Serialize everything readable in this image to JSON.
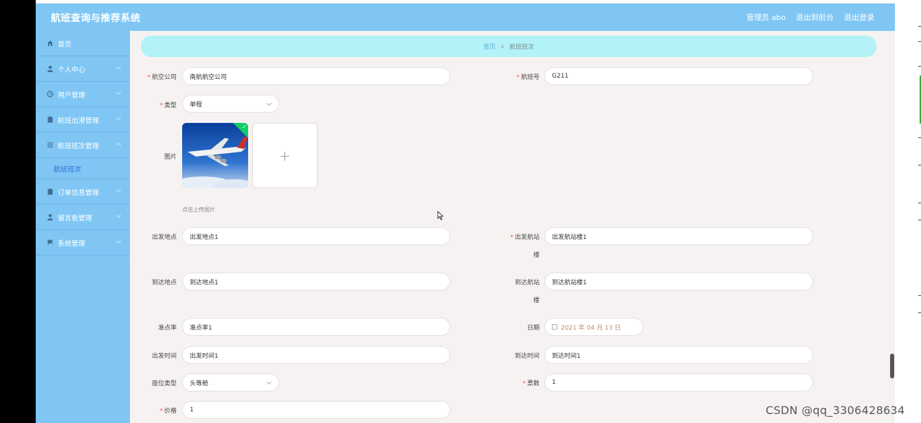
{
  "app": {
    "title": "航班查询与推荐系统"
  },
  "header": {
    "admin_label": "管理员 abo",
    "to_front_label": "退出到前台",
    "logout_label": "退出登录"
  },
  "sidebar": {
    "items": [
      {
        "label": "首页",
        "icon": "home-icon"
      },
      {
        "label": "个人中心",
        "icon": "user-icon"
      },
      {
        "label": "用户管理",
        "icon": "clock-icon"
      },
      {
        "label": "航班出港管理",
        "icon": "clipboard-icon"
      },
      {
        "label": "航班班次管理",
        "icon": "list-icon",
        "expanded": true,
        "children": [
          {
            "label": "航班班次",
            "active": true
          }
        ]
      },
      {
        "label": "订单信息管理",
        "icon": "clipboard-icon"
      },
      {
        "label": "留言板管理",
        "icon": "user-icon"
      },
      {
        "label": "系统管理",
        "icon": "flag-icon"
      }
    ]
  },
  "breadcrumb": {
    "home": "首页",
    "current": "航班班次"
  },
  "form": {
    "airline": {
      "label": "航空公司",
      "value": "南航航空公司",
      "required": true
    },
    "flight_no": {
      "label": "航班号",
      "value": "G211",
      "required": true
    },
    "type": {
      "label": "类型",
      "value": "单程",
      "required": true
    },
    "image": {
      "label": "图片",
      "hint": "点击上传图片",
      "plus": "+"
    },
    "depart_place": {
      "label": "出发地点",
      "value": "出发地点1"
    },
    "depart_terminal": {
      "label_line1": "出发航站",
      "label_line2": "楼",
      "value": "出发航站楼1",
      "required": true
    },
    "arrive_place": {
      "label": "到达地点",
      "value": "到达地点1"
    },
    "arrive_terminal": {
      "label_line1": "到达航站",
      "label_line2": "楼",
      "value": "到达航站楼1"
    },
    "on_time_rate": {
      "label": "准点率",
      "value": "准点率1"
    },
    "date": {
      "label": "日期",
      "value": "2021 年 04 月 13 日"
    },
    "depart_time": {
      "label": "出发时间",
      "value": "出发时间1"
    },
    "arrive_time": {
      "label": "到达时间",
      "value": "到达时间1"
    },
    "seat_type": {
      "label": "座位类型",
      "value": "头等舱"
    },
    "tickets": {
      "label": "票数",
      "value": "1",
      "required": true
    },
    "price": {
      "label": "价格",
      "value": "1",
      "required": true
    }
  },
  "watermark": "CSDN @qq_3306428634",
  "colors": {
    "header": "#7fc6f4",
    "breadcrumb": "#b3f3f7",
    "main_bg": "#f7f2f2",
    "required": "#ee5555"
  }
}
